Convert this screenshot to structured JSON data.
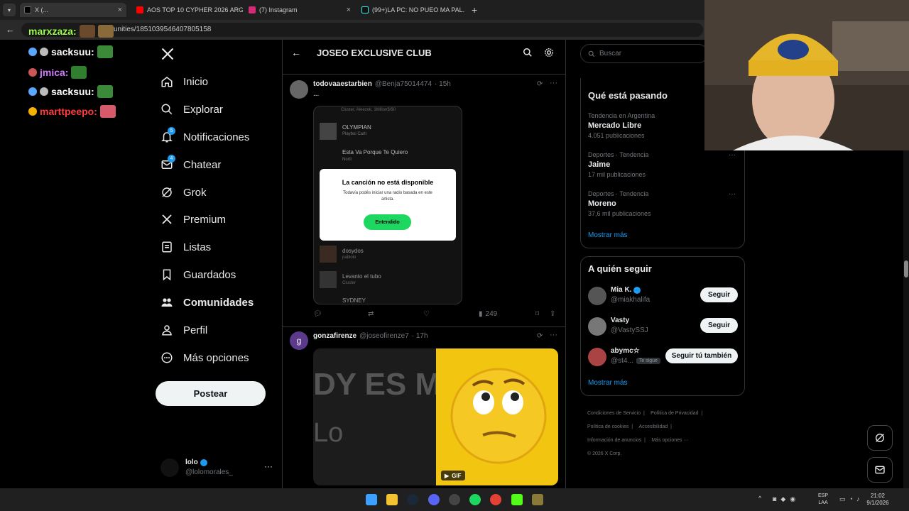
{
  "browser": {
    "tabs": [
      {
        "label": "X (..."
      },
      {
        "label": "AOS TOP 10 CYPHER 2026 ARG"
      },
      {
        "label": "(7) Instagram"
      },
      {
        "label": "(99+)LA PC: NO PUEO MA PAL..."
      }
    ],
    "url": "unities/1851039546407805158"
  },
  "chat": [
    {
      "user": "marxzaza:",
      "color": "#9dff4a"
    },
    {
      "user": "sacksuu:",
      "color": "#ffffff"
    },
    {
      "user": "jmica:",
      "color": "#d07cff"
    },
    {
      "user": "sacksuu:",
      "color": "#ffffff"
    },
    {
      "user": "marttpeepo:",
      "color": "#ff3b3b"
    }
  ],
  "sidebar": {
    "items": [
      {
        "label": "Inicio",
        "icon": "home-icon"
      },
      {
        "label": "Explorar",
        "icon": "search-icon"
      },
      {
        "label": "Notificaciones",
        "icon": "bell-icon",
        "badge": "5"
      },
      {
        "label": "Chatear",
        "icon": "mail-icon",
        "badge": "4"
      },
      {
        "label": "Grok",
        "icon": "grok-icon"
      },
      {
        "label": "Premium",
        "icon": "x-icon"
      },
      {
        "label": "Listas",
        "icon": "list-icon"
      },
      {
        "label": "Guardados",
        "icon": "bookmark-icon"
      },
      {
        "label": "Comunidades",
        "icon": "communities-icon"
      },
      {
        "label": "Perfil",
        "icon": "person-icon"
      },
      {
        "label": "Más opciones",
        "icon": "more-circle-icon"
      }
    ],
    "post_label": "Postear",
    "account": {
      "name": "lolo",
      "handle": "@lolomorales_"
    }
  },
  "header": {
    "title": "JOSEO EXCLUSIVE CLUB"
  },
  "posts": [
    {
      "user": "todovaaestarbien",
      "handle": "@Benja75014474",
      "time": "· 15h",
      "text": "...",
      "views": "249",
      "media": {
        "rows": [
          {
            "title": "",
            "sub": "Cluster, Aleezok, 1Millon$/$0"
          },
          {
            "title": "OLYMPIAN",
            "sub": "Playboi Carti"
          },
          {
            "title": "Esta Va Porque Te Quiero",
            "sub": "Nortt"
          },
          {
            "title": "dosydos",
            "sub": "pablolo"
          },
          {
            "title": "Levanto el tubo",
            "sub": "Cluster"
          },
          {
            "title": "SYDNEY",
            "sub": ""
          }
        ],
        "dialog_title": "La canción no está disponible",
        "dialog_text": "Todavía podés iniciar una radio basada en este artista.",
        "dialog_button": "Entendido"
      }
    },
    {
      "user": "gonzafirenze",
      "handle": "@joseofirenze7",
      "time": "· 17h",
      "avatar_letter": "g",
      "gif_text_top": "DY ES M",
      "gif_text_bottom": "Lo",
      "gif_label": "GIF"
    }
  ],
  "search": {
    "placeholder": "Buscar"
  },
  "trends": {
    "title": "Qué está pasando",
    "items": [
      {
        "category": "Tendencia en Argentina",
        "name": "Mercado Libre",
        "count": "4.051 publicaciones"
      },
      {
        "category": "Deportes · Tendencia",
        "name": "Jaime",
        "count": "17 mil publicaciones"
      },
      {
        "category": "Deportes · Tendencia",
        "name": "Moreno",
        "count": "37,6 mil publicaciones"
      }
    ],
    "show_more": "Mostrar más"
  },
  "who_to_follow": {
    "title": "A quién seguir",
    "items": [
      {
        "name": "Mia K.",
        "handle": "@miakhalifa",
        "button": "Seguir"
      },
      {
        "name": "Vasty",
        "handle": "@VastySSJ",
        "button": "Seguir"
      },
      {
        "name": "abymc☆",
        "handle": "@st4...",
        "tag": "Te sigue",
        "button": "Seguir tú también"
      }
    ],
    "show_more": "Mostrar más"
  },
  "footer": {
    "links": [
      "Condiciones de Servicio",
      "Política de Privacidad",
      "Política de cookies",
      "Accesibilidad",
      "Información de anuncios",
      "Más opciones ···"
    ],
    "copyright": "© 2026 X Corp."
  },
  "taskbar": {
    "lang": "ESP",
    "lang2": "LAA",
    "time": "21:02",
    "date": "9/1/2026"
  },
  "colors": {
    "accent": "#1d9bf0",
    "spotify_green": "#1ed760",
    "gif_yellow": "#f2c511"
  }
}
